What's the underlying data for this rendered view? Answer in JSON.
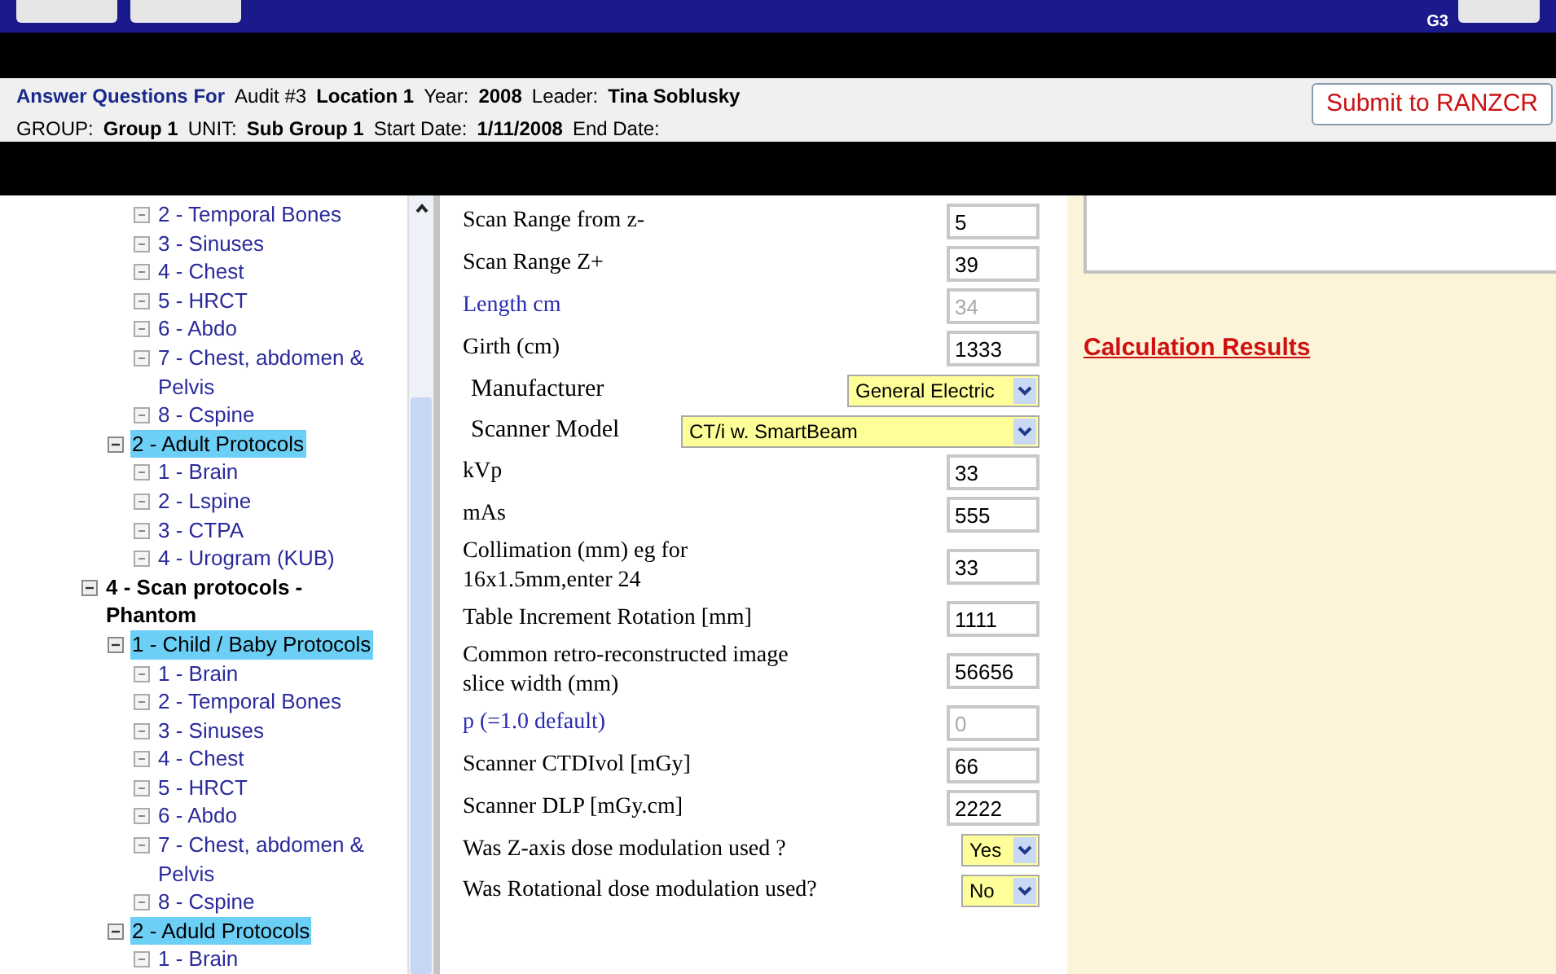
{
  "title_bar": {
    "badge": "G3"
  },
  "header": {
    "title": "Answer Questions For",
    "submit": "Submit to RANZCR",
    "lines": [
      [
        {
          "kind": "label",
          "text": "Audit #3"
        },
        {
          "kind": "value",
          "text": "Location 1"
        },
        {
          "kind": "label",
          "text": "Year:"
        },
        {
          "kind": "value",
          "text": "2008"
        },
        {
          "kind": "label",
          "text": "Leader:"
        },
        {
          "kind": "value",
          "text": "Tina Soblusky"
        }
      ],
      [
        {
          "kind": "label",
          "text": "GROUP:"
        },
        {
          "kind": "value",
          "text": "Group 1"
        },
        {
          "kind": "label",
          "text": "UNIT:"
        },
        {
          "kind": "value",
          "text": "Sub Group 1"
        },
        {
          "kind": "label",
          "text": "Start Date:"
        },
        {
          "kind": "value",
          "text": "1/11/2008"
        },
        {
          "kind": "label",
          "text": "End Date:"
        }
      ]
    ]
  },
  "tree": [
    {
      "children": [
        {
          "children": [
            {
              "label": "2 - Temporal Bones",
              "selected": false
            },
            {
              "label": "3 - Sinuses",
              "selected": false
            },
            {
              "label": "4 - Chest",
              "selected": false
            },
            {
              "label": "5 - HRCT",
              "selected": false
            },
            {
              "label": "6 - Abdo",
              "selected": false
            },
            {
              "label": "7 - Chest, abdomen & Pelvis",
              "selected": false
            },
            {
              "label": "8 - Cspine",
              "selected": false
            }
          ]
        },
        {
          "label": "2 - Adult Protocols",
          "selected": true,
          "children": [
            {
              "label": "1 - Brain",
              "selected": false
            },
            {
              "label": "2 - Lspine",
              "selected": false
            },
            {
              "label": "3 - CTPA",
              "selected": false
            },
            {
              "label": "4 - Urogram (KUB)",
              "selected": false
            }
          ]
        }
      ]
    },
    {
      "label": "4 - Scan protocols - Phantom",
      "selected": false,
      "children": [
        {
          "label": "1 - Child / Baby Protocols",
          "selected": true,
          "children": [
            {
              "label": "1 - Brain",
              "selected": false
            },
            {
              "label": "2 - Temporal Bones",
              "selected": false
            },
            {
              "label": "3 - Sinuses",
              "selected": false
            },
            {
              "label": "4 - Chest",
              "selected": false
            },
            {
              "label": "5 - HRCT",
              "selected": false
            },
            {
              "label": "6 - Abdo",
              "selected": false
            },
            {
              "label": "7 - Chest, abdomen & Pelvis",
              "selected": false
            },
            {
              "label": "8 - Cspine",
              "selected": false
            }
          ]
        },
        {
          "label": "2 - Aduld Protocols",
          "selected": true,
          "children": [
            {
              "label": "1 - Brain",
              "selected": false
            }
          ]
        }
      ]
    }
  ],
  "form": [
    {
      "kind": "input",
      "label": "Scan Range from z-",
      "value": "5",
      "disabled": false
    },
    {
      "kind": "input",
      "label": "Scan Range Z+",
      "value": "39",
      "disabled": false
    },
    {
      "kind": "input",
      "label": "Length cm",
      "value": "34",
      "disabled": true
    },
    {
      "kind": "input",
      "label": "Girth (cm)",
      "value": "1333",
      "disabled": false
    },
    {
      "kind": "select",
      "label": "Manufacturer",
      "value": "General Electric",
      "wide": false
    },
    {
      "kind": "select",
      "label": "Scanner Model",
      "value": "CT/i w. SmartBeam",
      "wide": true
    },
    {
      "kind": "input",
      "label": "kVp",
      "value": "33",
      "disabled": false
    },
    {
      "kind": "input",
      "label": "mAs",
      "value": "555",
      "disabled": false
    },
    {
      "kind": "input",
      "label": "Collimation (mm) eg for 16x1.5mm,enter 24",
      "value": "33",
      "disabled": false
    },
    {
      "kind": "input",
      "label": "Table Increment Rotation [mm]",
      "value": "1111",
      "disabled": false
    },
    {
      "kind": "input",
      "label": "Common retro-reconstructed image slice width (mm)",
      "value": "56656",
      "disabled": false
    },
    {
      "kind": "input",
      "label": "p (=1.0 default)",
      "value": "0",
      "disabled": true
    },
    {
      "kind": "input",
      "label": "Scanner CTDIvol [mGy]",
      "value": "66",
      "disabled": false
    },
    {
      "kind": "input",
      "label": "Scanner DLP [mGy.cm]",
      "value": "2222",
      "disabled": false
    },
    {
      "kind": "yesno",
      "label": "Was Z-axis dose modulation used ?",
      "value": "Yes"
    },
    {
      "kind": "yesno",
      "label": "Was Rotational dose modulation used?",
      "value": "No"
    }
  ],
  "results": {
    "link": "Calculation Results"
  }
}
